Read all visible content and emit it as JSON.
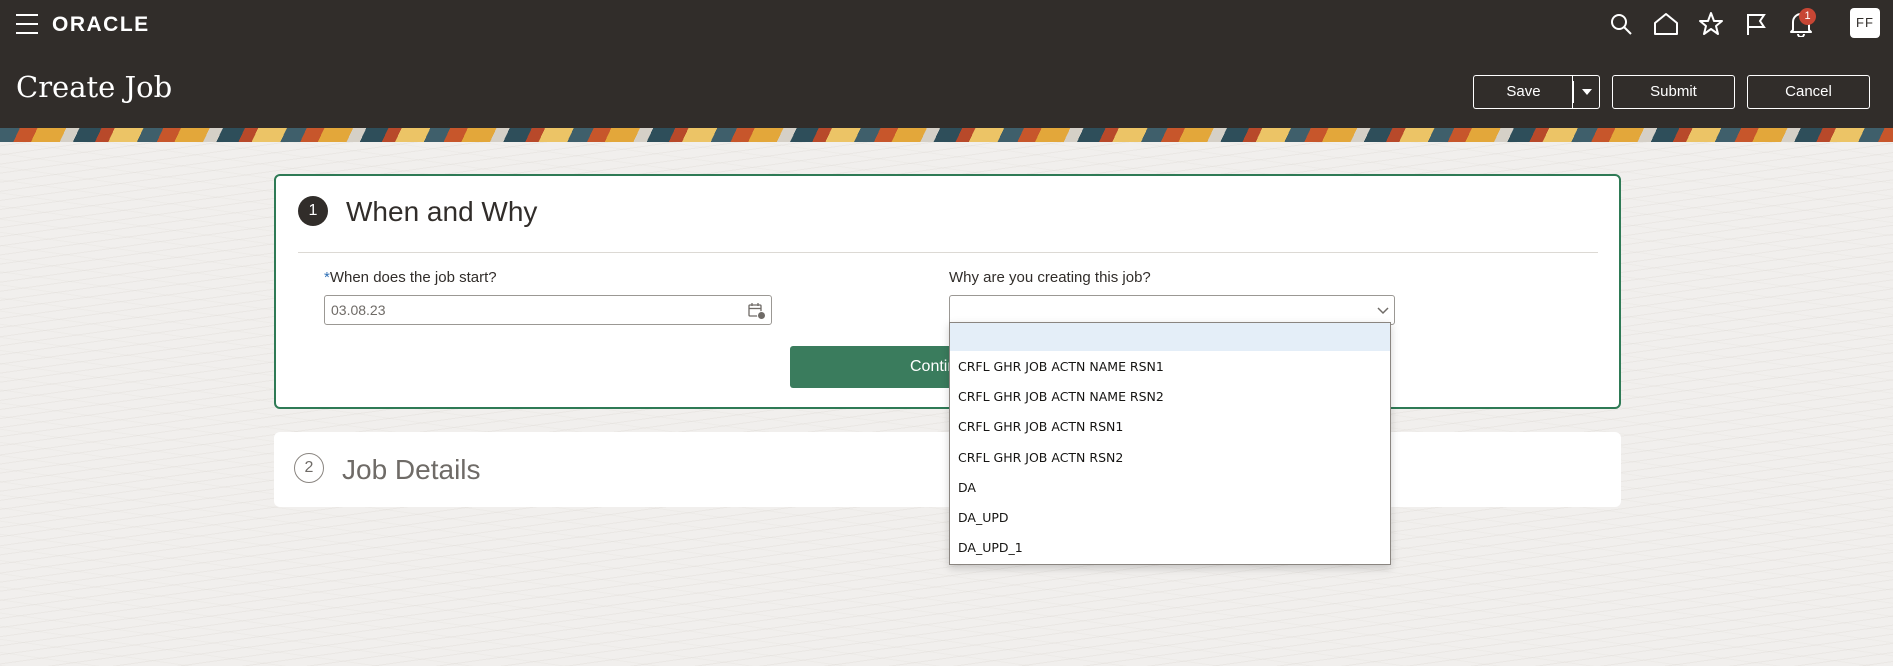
{
  "header": {
    "logo": "ORACLE",
    "page_title": "Create Job",
    "notification_count": "1",
    "avatar_initials": "FF",
    "buttons": {
      "save": "Save",
      "submit": "Submit",
      "cancel": "Cancel"
    }
  },
  "step1": {
    "number": "1",
    "title": "When and Why",
    "start_label_required": "*",
    "start_label": "When does the job start?",
    "start_value": "03.08.23",
    "reason_label": "Why are you creating this job?",
    "reason_value": "",
    "continue_label": "Continue"
  },
  "step2": {
    "number": "2",
    "title": "Job Details"
  },
  "dropdown": {
    "options": [
      "",
      "CRFL GHR JOB ACTN NAME RSN1",
      "CRFL GHR JOB ACTN NAME RSN2",
      "CRFL GHR JOB ACTN RSN1",
      "CRFL GHR JOB ACTN RSN2",
      "DA",
      "DA_UPD",
      "DA_UPD_1"
    ]
  },
  "colors": {
    "header_bg": "#312d2a",
    "accent_green": "#3a7c5d",
    "badge_red": "#c74634"
  }
}
